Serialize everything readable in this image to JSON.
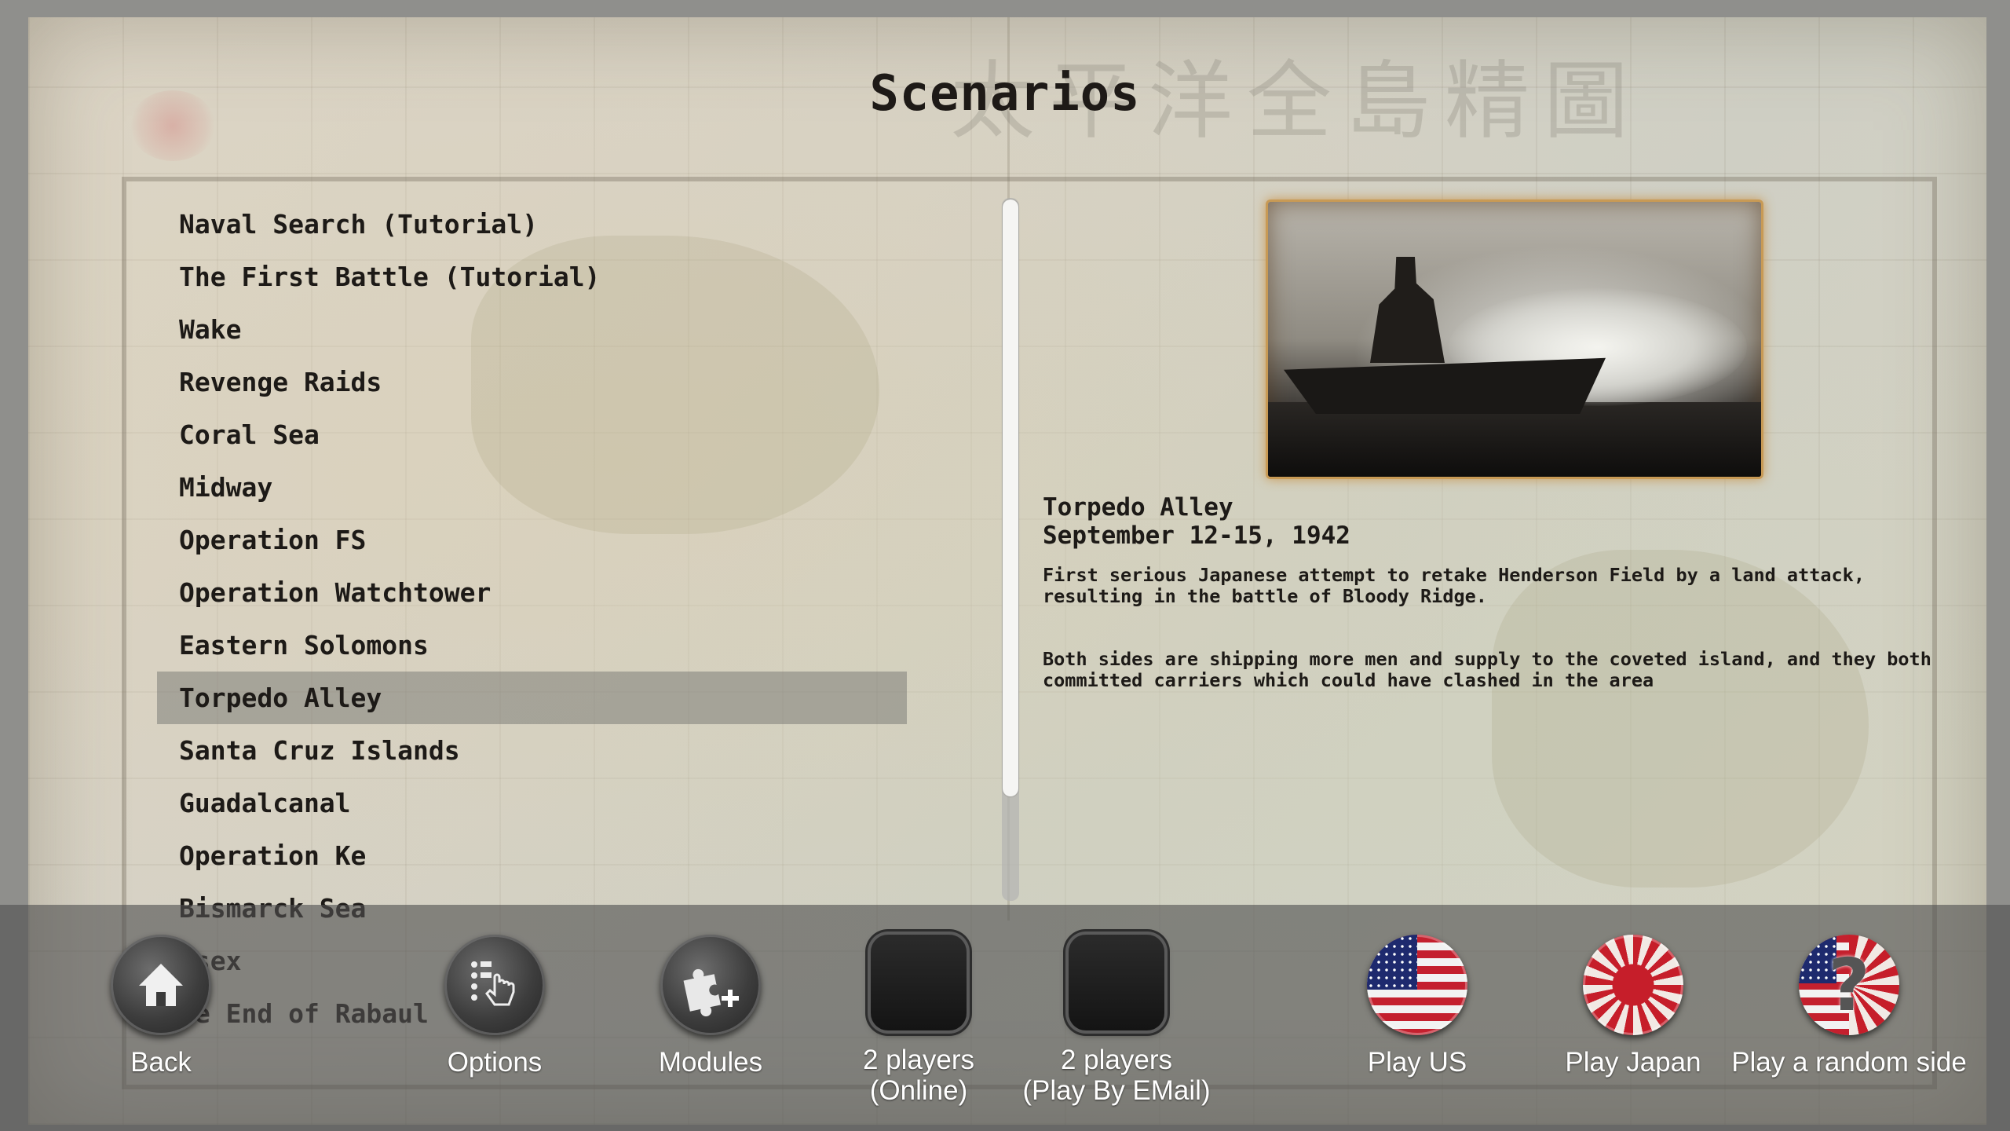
{
  "screen": {
    "title": "Scenarios",
    "map_banner": "太平洋全島精圖"
  },
  "scenarios": {
    "selected_index": 9,
    "items": [
      {
        "label": "Naval Search (Tutorial)"
      },
      {
        "label": "The First Battle (Tutorial)"
      },
      {
        "label": "Wake"
      },
      {
        "label": "Revenge Raids"
      },
      {
        "label": "Coral Sea"
      },
      {
        "label": "Midway"
      },
      {
        "label": "Operation FS"
      },
      {
        "label": "Operation Watchtower"
      },
      {
        "label": "Eastern Solomons"
      },
      {
        "label": "Torpedo Alley"
      },
      {
        "label": "Santa Cruz Islands"
      },
      {
        "label": "Guadalcanal"
      },
      {
        "label": "Operation Ke"
      },
      {
        "label": "Bismarck Sea"
      },
      {
        "label": "ssex"
      },
      {
        "label": "he End of Rabaul"
      }
    ]
  },
  "detail": {
    "name": "Torpedo Alley",
    "date": "September 12-15, 1942",
    "paragraph1": "First serious Japanese attempt to retake Henderson Field by a land attack,\nresulting in the battle of Bloody Ridge.",
    "paragraph2": "Both sides are shipping more men and supply to the coveted island, and they both\ncommitted carriers which could have clashed in the area",
    "image": "aircraft-carrier-photo"
  },
  "toolbar": {
    "back": {
      "label": "Back",
      "icon": "home-icon"
    },
    "options": {
      "label": "Options",
      "icon": "touch-options-icon"
    },
    "modules": {
      "label": "Modules",
      "icon": "puzzle-add-icon"
    },
    "two_players_online": {
      "line1": "2 players",
      "line2": "(Online)"
    },
    "two_players_pbem": {
      "line1": "2 players",
      "line2": "(Play By EMail)"
    },
    "play_us": {
      "label": "Play US",
      "icon": "us-flag-icon"
    },
    "play_japan": {
      "label": "Play Japan",
      "icon": "japan-flag-icon"
    },
    "play_random": {
      "label": "Play a random side",
      "icon": "random-side-icon"
    }
  },
  "colors": {
    "selected_row": "#7d7d78",
    "text": "#1d1a17",
    "photo_border": "#c89a55",
    "toolbar_bg": "#505050"
  }
}
